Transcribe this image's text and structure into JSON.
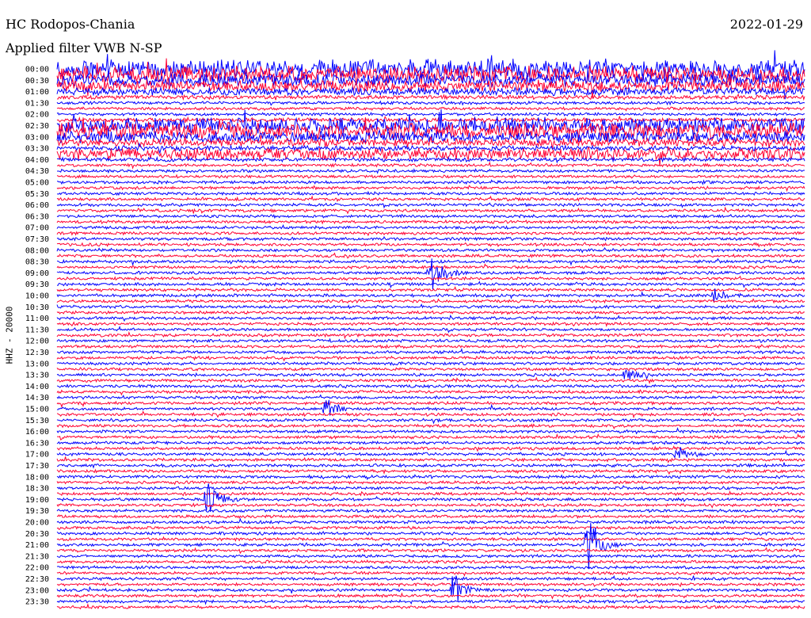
{
  "header": {
    "station": "HC Rodopos-Chania",
    "date": "2022-01-29",
    "filter": "Applied filter VWB N-SP"
  },
  "chart_data": {
    "type": "line",
    "title": "HC Rodopos-Chania",
    "date": "2022-01-29",
    "filter": "Applied filter VWB N-SP",
    "channel_label": "HHZ - 20000",
    "trace_interval_minutes": 15,
    "colors": {
      "trace_a": "#0000ff",
      "trace_b": "#ff0033"
    },
    "tick_labels": [
      "00:00",
      "00:30",
      "01:00",
      "01:30",
      "02:00",
      "02:30",
      "03:00",
      "03:30",
      "04:00",
      "04:30",
      "05:00",
      "05:30",
      "06:00",
      "06:30",
      "07:00",
      "07:30",
      "08:00",
      "08:30",
      "09:00",
      "09:30",
      "10:00",
      "10:30",
      "11:00",
      "11:30",
      "12:00",
      "12:30",
      "13:00",
      "13:30",
      "14:00",
      "14:30",
      "15:00",
      "15:30",
      "16:00",
      "16:30",
      "17:00",
      "17:30",
      "18:00",
      "18:30",
      "19:00",
      "19:30",
      "20:00",
      "20:30",
      "21:00",
      "21:30",
      "22:00",
      "22:30",
      "23:00",
      "23:30"
    ],
    "noise_levels": [
      10,
      9,
      7,
      6,
      4,
      2,
      1.5,
      1.5,
      1.5,
      2,
      8,
      9,
      6,
      4,
      2.5,
      6,
      2,
      1.5,
      1.5,
      1.5,
      1.5,
      1.5,
      1.5,
      1.5,
      1.5,
      1.5,
      1.5,
      1.5,
      1.5,
      1.5,
      1.5,
      1.5,
      1.5,
      1.5,
      1.5,
      1.5,
      1.5,
      1.5,
      1.5,
      1.5,
      1.5,
      1.5,
      1.5,
      1.5,
      1.5,
      1.5,
      1.5,
      1.5,
      1.5,
      1.5,
      1.5,
      1.5,
      1.5,
      1.5,
      1.5,
      1.5,
      1.5,
      1.5,
      1.5,
      1.5,
      1.5,
      1.5,
      1.5,
      1.5,
      1.5,
      1.5,
      1.5,
      1.5,
      1.5,
      1.5,
      1.5,
      1.5,
      1.5,
      1.5,
      1.5,
      1.5,
      1.5,
      1.5,
      1.5,
      1.5,
      1.5,
      1.5,
      1.5,
      1.5,
      1.5,
      1.5,
      1.5,
      1.5,
      1.5,
      1.5,
      1.5,
      1.5,
      1.5,
      1.5,
      1.5,
      1.5
    ],
    "events": [
      {
        "trace": 18,
        "pos": 0.5,
        "amp": 38
      },
      {
        "trace": 20,
        "pos": 0.88,
        "amp": 10
      },
      {
        "trace": 27,
        "pos": 0.76,
        "amp": 14
      },
      {
        "trace": 30,
        "pos": 0.36,
        "amp": 16
      },
      {
        "trace": 34,
        "pos": 0.83,
        "amp": 16
      },
      {
        "trace": 38,
        "pos": 0.2,
        "amp": 34
      },
      {
        "trace": 42,
        "pos": 0.71,
        "amp": 50
      },
      {
        "trace": 46,
        "pos": 0.53,
        "amp": 24
      }
    ]
  }
}
